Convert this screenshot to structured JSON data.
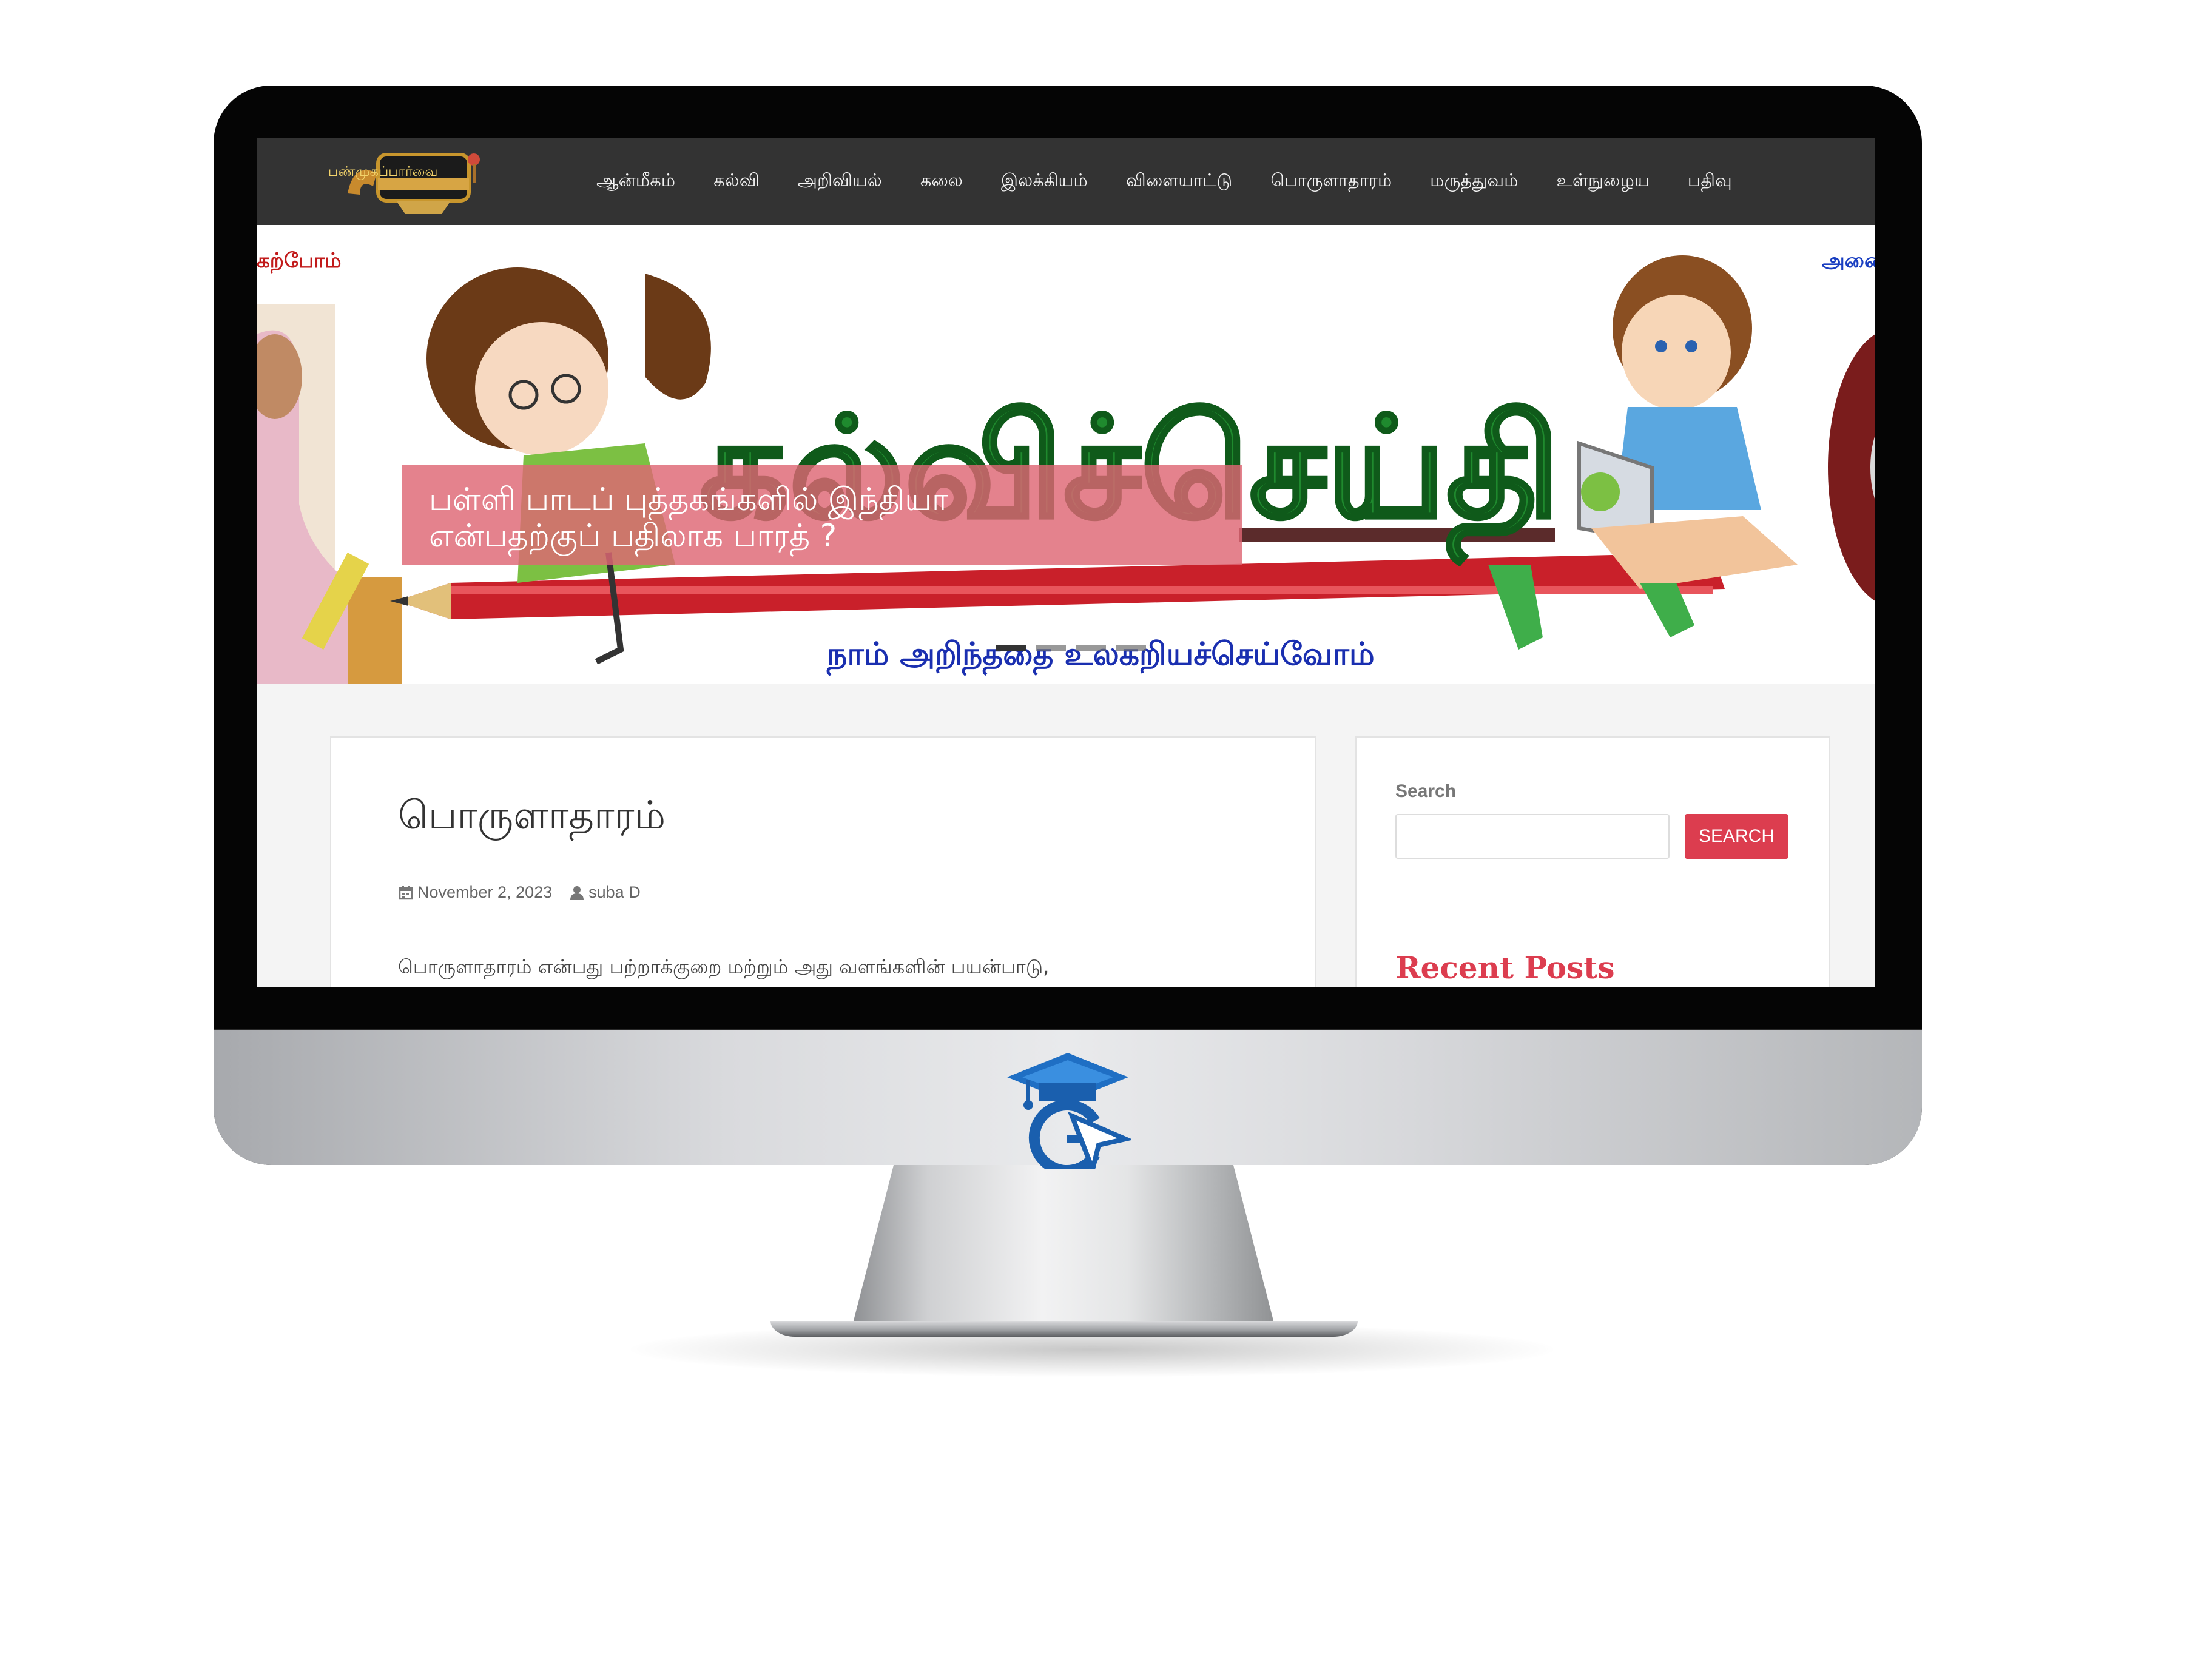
{
  "site": {
    "logo_text": "பண்முகப்பார்வை",
    "nav": [
      "ஆன்மீகம்",
      "கல்வி",
      "அறிவியல்",
      "கலை",
      "இலக்கியம்",
      "விளையாட்டு",
      "பொருளாதாரம்",
      "மருத்துவம்",
      "உள்நுழைய",
      "பதிவு"
    ]
  },
  "hero": {
    "title": "கல்விச்செய்தி",
    "tagline": "நாம் அறிந்ததை உலகறியச்செய்வோம்",
    "left_edge_text": "கற்போம்",
    "right_edge_text": "அனை",
    "caption_line1": "பள்ளி பாடப் புத்தகங்களில் இந்தியா",
    "caption_line2": "என்பதற்குப் பதிலாக பாரத் ?"
  },
  "post": {
    "title": "பொருளாதாரம்",
    "date": "November 2, 2023",
    "author": "suba D",
    "excerpt": "பொருளாதாரம் என்பது பற்றாக்குறை மற்றும் அது வளங்களின் பயன்பாடு,"
  },
  "sidebar": {
    "search_label": "Search",
    "search_value": "",
    "search_button": "SEARCH",
    "recent_posts_title": "Recent Posts"
  },
  "colors": {
    "nav_bg": "#333333",
    "accent": "#dc3d4f",
    "caption_bg": "#de6674",
    "hero_title_green": "#1f8a2e"
  },
  "icons": [
    "calendar-icon",
    "user-icon",
    "graduation-cap-logo-icon"
  ]
}
